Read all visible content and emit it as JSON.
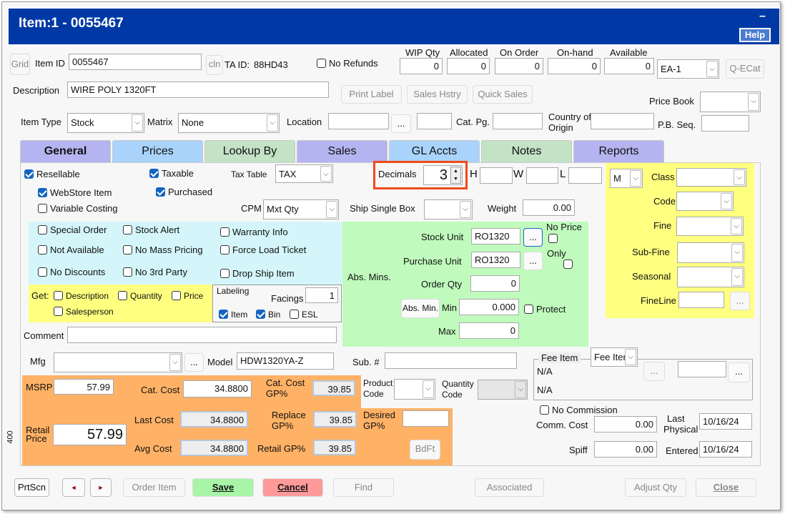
{
  "window": {
    "title": "Item:1 - 0055467",
    "minimize": "–",
    "help": "Help"
  },
  "colors": {
    "title_bar": "#0039a6",
    "tab_purple": "#b4b4f0",
    "tab_blue": "#a9d3fb",
    "tab_green": "#c3e2c6",
    "yellow": "#ffff80",
    "cyan": "#d4f6fa",
    "green": "#c0fbbd",
    "orange": "#ffb266",
    "highlight": "#f04a1a"
  },
  "header": {
    "grid": "Grid",
    "item_id_label": "Item ID",
    "item_id": "0055467",
    "cln": "cln",
    "ta_id_label": "TA ID:",
    "ta_id": "88HD43",
    "no_refunds": "No Refunds",
    "qty": [
      {
        "label": "WIP Qty",
        "value": "0"
      },
      {
        "label": "Allocated",
        "value": "0"
      },
      {
        "label": "On Order",
        "value": "0"
      },
      {
        "label": "On-hand",
        "value": "0"
      },
      {
        "label": "Available",
        "value": "0"
      }
    ],
    "unit_select": "EA-1",
    "qecat": "Q-ECat",
    "description_label": "Description",
    "description": "WIRE POLY 1320FT",
    "print_label": "Print Label",
    "sales_history": "Sales Hstry",
    "quick_sales": "Quick Sales",
    "price_book_label": "Price Book",
    "price_book": "",
    "item_type_label": "Item Type",
    "item_type": "Stock",
    "matrix_label": "Matrix",
    "matrix": "None",
    "location_label": "Location",
    "ellipsis": "...",
    "cat_pg_label": "Cat. Pg.",
    "country_label_1": "Country of",
    "country_label_2": "Origin",
    "pb_seq_label": "P.B. Seq."
  },
  "tabs": [
    {
      "label": "General",
      "active": true
    },
    {
      "label": "Prices"
    },
    {
      "label": "Lookup By"
    },
    {
      "label": "Sales"
    },
    {
      "label": "GL Accts"
    },
    {
      "label": "Notes"
    },
    {
      "label": "Reports"
    }
  ],
  "general": {
    "resellable": "Resellable",
    "taxable": "Taxable",
    "tax_table_label": "Tax Table",
    "tax_table": "TAX",
    "decimals_label": "Decimals",
    "decimals": "3",
    "h": "H",
    "w": "W",
    "l": "L",
    "webstore": "WebStore Item",
    "purchased": "Purchased",
    "variable_costing": "Variable Costing",
    "cpm_label": "CPM",
    "cpm": "Mxt Qty",
    "ship_single_box": "Ship Single Box",
    "weight_label": "Weight",
    "weight": "0.00",
    "flags": [
      "Special Order",
      "Stock Alert",
      "Warranty Info",
      "Not Available",
      "No Mass Pricing",
      "Force Load Ticket",
      "No Discounts",
      "No 3rd Party",
      "Drop Ship Item"
    ],
    "get_label": "Get:",
    "get": [
      "Description",
      "Quantity",
      "Price",
      "Salesperson"
    ],
    "labeling": "Labeling",
    "facings_label": "Facings",
    "facings": "1",
    "label_item": "Item",
    "label_bin": "Bin",
    "label_esl": "ESL",
    "stock_unit_label": "Stock Unit",
    "stock_unit": "RO1320",
    "purchase_unit_label": "Purchase Unit",
    "purchase_unit": "RO1320",
    "no_price": "No Price",
    "only": "Only",
    "abs_mins": "Abs. Mins.",
    "order_qty_label": "Order Qty",
    "order_qty": "0",
    "abs_min_btn": "Abs. Min.",
    "min_label": "Min",
    "min": "0.000",
    "protect": "Protect",
    "max_label": "Max",
    "max": "0",
    "m_select": "M",
    "class": "Class",
    "code": "Code",
    "fine": "Fine",
    "sub_fine": "Sub-Fine",
    "seasonal": "Seasonal",
    "fineline": "FineLine",
    "comment_label": "Comment",
    "mfg_label": "Mfg",
    "model_label": "Model",
    "model": "HDW1320YA-Z",
    "sub_label": "Sub. #",
    "fee_item_label": "Fee Item",
    "fee_item_select": "Fee Iter",
    "na1": "N/A",
    "na2": "N/A",
    "msrp_label": "MSRP",
    "msrp": "57.99",
    "cat_cost_label": "Cat. Cost",
    "cat_cost": "34.8800",
    "cat_cost_gp_1": "Cat. Cost",
    "cat_cost_gp_2": "GP%",
    "cat_cost_gp": "39.85",
    "product_code_1": "Product",
    "product_code_2": "Code",
    "quantity_code_1": "Quantity",
    "quantity_code_2": "Code",
    "retail_price_1": "Retail",
    "retail_price_2": "Price",
    "retail_price": "57.99",
    "last_cost_label": "Last Cost",
    "last_cost": "34.8800",
    "replace_gp_1": "Replace",
    "replace_gp_2": "GP%",
    "replace_gp": "39.85",
    "desired_gp_1": "Desired",
    "desired_gp_2": "GP%",
    "avg_cost_label": "Avg Cost",
    "avg_cost": "34.8800",
    "retail_gp_label": "Retail GP%",
    "retail_gp": "39.85",
    "bdft": "BdFt",
    "side_number": "400",
    "no_commission": "No Commission",
    "comm_cost_label": "Comm. Cost",
    "comm_cost": "0.00",
    "last_physical_1": "Last",
    "last_physical_2": "Physical",
    "last_physical": "10/16/24",
    "spiff_label": "Spiff",
    "spiff": "0.00",
    "entered_label": "Entered",
    "entered": "10/16/24"
  },
  "footer": {
    "prtscn": "PrtScn",
    "prev": "◄",
    "next": "►",
    "order_item": "Order Item",
    "save": "Save",
    "cancel": "Cancel",
    "find": "Find",
    "associated": "Associated",
    "adjust_qty": "Adjust Qty",
    "close": "Close"
  }
}
